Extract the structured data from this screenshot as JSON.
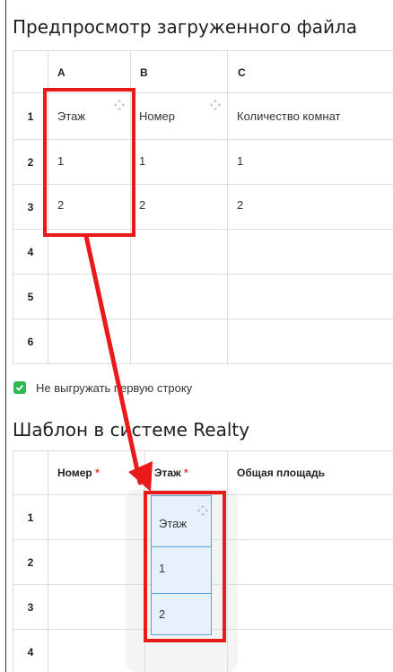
{
  "preview": {
    "title": "Предпросмотр загруженного файла",
    "columns": [
      "A",
      "B",
      "C"
    ],
    "row_numbers": [
      "1",
      "2",
      "3",
      "4",
      "5",
      "6"
    ],
    "rows": [
      [
        "Этаж",
        "Номер",
        "Количество комнат"
      ],
      [
        "1",
        "1",
        "1"
      ],
      [
        "2",
        "2",
        "2"
      ]
    ]
  },
  "skip_first_row": {
    "checked": true,
    "label": "Не выгружать первую строку"
  },
  "template": {
    "title": "Шаблон в системе Realty",
    "columns": [
      {
        "label": "Номер",
        "required": "*"
      },
      {
        "label": "Этаж",
        "required": "*"
      },
      {
        "label": "Общая площадь",
        "required": ""
      }
    ],
    "row_numbers": [
      "1",
      "2",
      "3",
      "4"
    ],
    "mapped_values": [
      "Этаж",
      "1",
      "2"
    ]
  },
  "colors": {
    "highlight_red": "#ea1a1a",
    "checkbox_green": "#2db84d",
    "target_fill": "#e7f1fb",
    "target_border": "#5da0d6"
  },
  "icons": [
    "move-icon",
    "checkmark-icon",
    "arrow-icon"
  ]
}
